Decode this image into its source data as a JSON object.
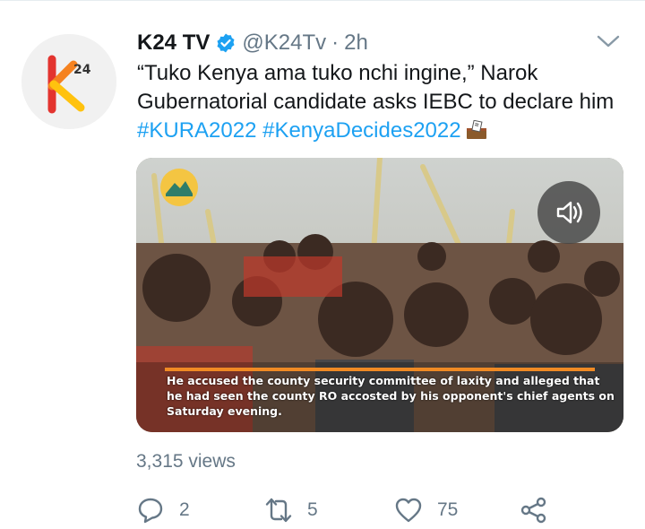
{
  "tweet": {
    "author_name": "K24 TV",
    "handle": "@K24Tv",
    "separator": "·",
    "time": "2h",
    "avatar_text": "24",
    "text_plain": "“Tuko Kenya ama tuko nchi ingine,” Narok Gubernatorial candidate asks IEBC to declare him",
    "hashtags": [
      "#KURA2022",
      "#KenyaDecides2022"
    ],
    "ballot_emoji": "ballot-box-icon"
  },
  "media": {
    "subtitle": "He accused the county security committee of laxity and alleged that he had seen the county RO accosted by his opponent's chief agents on Saturday evening.",
    "sound_icon": "volume-icon"
  },
  "stats": {
    "views": "3,315 views"
  },
  "actions": {
    "replies": "2",
    "retweets": "5",
    "likes": "75"
  },
  "colors": {
    "link": "#1da1f2",
    "muted": "#657786",
    "text": "#14171a",
    "verified": "#1da1f2",
    "subtitle_bar": "#f08a24"
  }
}
